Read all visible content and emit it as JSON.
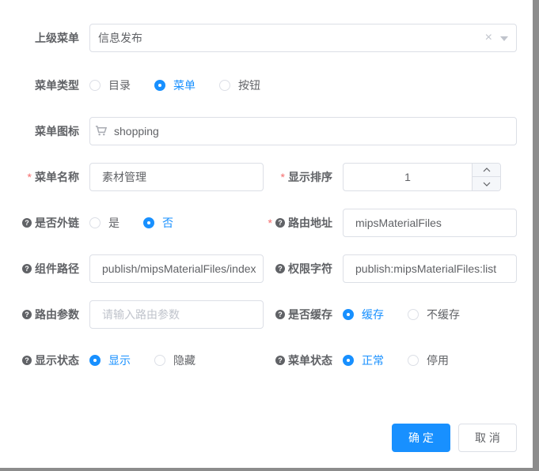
{
  "form": {
    "parent_menu": {
      "label": "上级菜单",
      "value": "信息发布"
    },
    "menu_type": {
      "label": "菜单类型",
      "options": [
        "目录",
        "菜单",
        "按钮"
      ],
      "selected": "菜单"
    },
    "menu_icon": {
      "label": "菜单图标",
      "value": "shopping",
      "icon": "shopping-cart-icon"
    },
    "menu_name": {
      "label": "菜单名称",
      "required_mark": "*",
      "value": "素材管理"
    },
    "display_order": {
      "label": "显示排序",
      "required_mark": "*",
      "value": "1"
    },
    "is_external": {
      "label": "是否外链",
      "options": [
        "是",
        "否"
      ],
      "selected": "否"
    },
    "route_address": {
      "label": "路由地址",
      "required_mark": "*",
      "value": "mipsMaterialFiles"
    },
    "component_path": {
      "label": "组件路径",
      "value": "publish/mipsMaterialFiles/index"
    },
    "permission": {
      "label": "权限字符",
      "value": "publish:mipsMaterialFiles:list"
    },
    "route_params": {
      "label": "路由参数",
      "placeholder": "请输入路由参数"
    },
    "is_cache": {
      "label": "是否缓存",
      "options": [
        "缓存",
        "不缓存"
      ],
      "selected": "缓存"
    },
    "visible": {
      "label": "显示状态",
      "options": [
        "显示",
        "隐藏"
      ],
      "selected": "显示"
    },
    "status": {
      "label": "菜单状态",
      "options": [
        "正常",
        "停用"
      ],
      "selected": "正常"
    }
  },
  "footer": {
    "confirm_label": "确 定",
    "cancel_label": "取 消"
  },
  "colors": {
    "primary": "#1890ff",
    "required": "#f56c6c",
    "border": "#dcdfe6"
  }
}
